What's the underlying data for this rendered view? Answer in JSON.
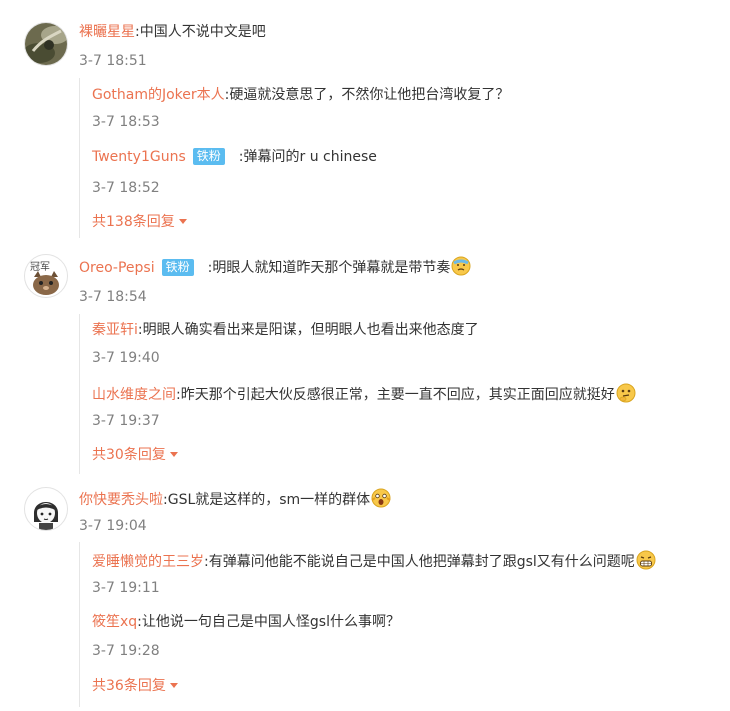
{
  "threads": [
    {
      "author": "裸曬星星",
      "sep": ":",
      "text": "中国人不说中文是吧",
      "time": "3-7 18:51",
      "replies": [
        {
          "author": "Gotham的Joker本人",
          "sep": ":",
          "text": "硬逼就没意思了，不然你让他把台湾收复了？",
          "time": "3-7 18:53"
        },
        {
          "author": "Twenty1Guns",
          "badge": "铁粉",
          "sep": ":",
          "text": "弹幕问的r u chinese",
          "time": "3-7 18:52"
        }
      ],
      "more": "共138条回复"
    },
    {
      "author": "Oreo-Pepsi",
      "badge": "铁粉",
      "sep": ":",
      "text": "明眼人就知道昨天那个弹幕就是带节奏",
      "time": "3-7 18:54",
      "replies": [
        {
          "author": "秦亚轩i",
          "sep": ":",
          "text": "明眼人确实看出来是阳谋，但明眼人也看出来他态度了",
          "time": "3-7 19:40"
        },
        {
          "author": "山水维度之间",
          "sep": ":",
          "text": "昨天那个引起大伙反感很正常，主要一直不回应，其实正面回应就挺好",
          "time": "3-7 19:37"
        }
      ],
      "more": "共30条回复"
    },
    {
      "author": "你快要秃头啦",
      "sep": ":",
      "text": "GSL就是这样的，sm一样的群体",
      "time": "3-7 19:04",
      "replies": [
        {
          "author": "爱睡懒觉的王三岁",
          "sep": ":",
          "text": "有弹幕问他能不能说自己是中国人他把弹幕封了跟gsl又有什么问题呢",
          "time": "3-7 19:11"
        },
        {
          "author": "筱笙xq",
          "sep": ":",
          "text": "让他说一句自己是中国人怪gsl什么事啊？",
          "time": "3-7 19:28"
        }
      ],
      "more": "共36条回复"
    }
  ],
  "colors": {
    "name": "#eb7350",
    "text": "#333333",
    "time": "#808080",
    "badge": "#5bbcf0"
  }
}
